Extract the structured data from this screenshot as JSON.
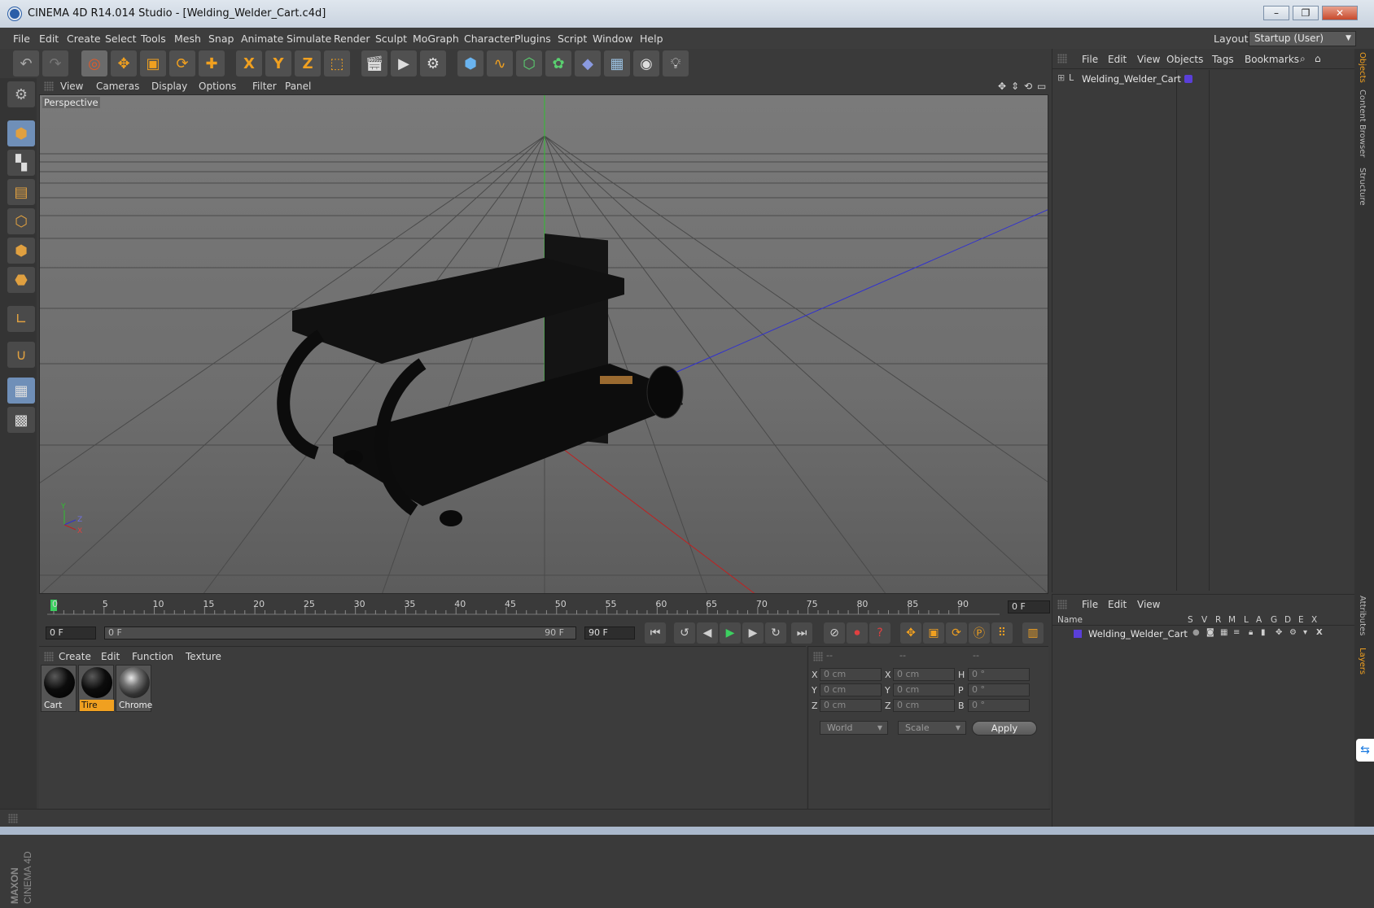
{
  "window": {
    "title": "CINEMA 4D R14.014 Studio - [Welding_Welder_Cart.c4d]",
    "buttons": [
      "–",
      "❐",
      "✕"
    ]
  },
  "menubar": {
    "items": [
      "File",
      "Edit",
      "Create",
      "Select",
      "Tools",
      "Mesh",
      "Snap",
      "Animate",
      "Simulate",
      "Render",
      "Sculpt",
      "MoGraph",
      "Character",
      "Plugins",
      "Script",
      "Window",
      "Help"
    ],
    "layout_label": "Layout:",
    "layout_value": "Startup (User)"
  },
  "toolbar": {
    "axis_x": "X",
    "axis_y": "Y",
    "axis_z": "Z"
  },
  "viewport": {
    "menu": [
      "View",
      "Cameras",
      "Display",
      "Options",
      "Filter",
      "Panel"
    ],
    "camera_label": "Perspective",
    "axis_gizmo": {
      "y": "Y",
      "z": "Z",
      "x": "X"
    }
  },
  "timeline": {
    "ticks": [
      "0",
      "5",
      "10",
      "15",
      "20",
      "25",
      "30",
      "35",
      "40",
      "45",
      "50",
      "55",
      "60",
      "65",
      "70",
      "75",
      "80",
      "85",
      "90"
    ],
    "current_frame": "0 F",
    "start_frame": "0 F",
    "range_start": "0 F",
    "range_end": "90 F",
    "end_frame": "90 F"
  },
  "materials": {
    "menu": [
      "Create",
      "Edit",
      "Function",
      "Texture"
    ],
    "items": [
      {
        "name": "Cart",
        "selected": false
      },
      {
        "name": "Tire",
        "selected": true
      },
      {
        "name": "Chrome",
        "selected": false
      }
    ]
  },
  "coordinates": {
    "headers": [
      "--",
      "--",
      "--"
    ],
    "position": [
      {
        "axis": "X",
        "value": "0 cm"
      },
      {
        "axis": "Y",
        "value": "0 cm"
      },
      {
        "axis": "Z",
        "value": "0 cm"
      }
    ],
    "size": [
      {
        "axis": "X",
        "value": "0 cm"
      },
      {
        "axis": "Y",
        "value": "0 cm"
      },
      {
        "axis": "Z",
        "value": "0 cm"
      }
    ],
    "rotation": [
      {
        "axis": "H",
        "value": "0 °"
      },
      {
        "axis": "P",
        "value": "0 °"
      },
      {
        "axis": "B",
        "value": "0 °"
      }
    ],
    "mode": "World",
    "size_mode": "Scale",
    "apply_label": "Apply"
  },
  "objects": {
    "menu": [
      "File",
      "Edit",
      "View",
      "Objects",
      "Tags",
      "Bookmarks"
    ],
    "tree": [
      {
        "name": "Welding_Welder_Cart",
        "color": "#5a3fd8"
      }
    ]
  },
  "layers": {
    "menu": [
      "File",
      "Edit",
      "View"
    ],
    "columns": [
      "Name",
      "S",
      "V",
      "R",
      "M",
      "L",
      "A",
      "G",
      "D",
      "E",
      "X"
    ],
    "rows": [
      {
        "name": "Welding_Welder_Cart",
        "color": "#5a3fd8"
      }
    ]
  },
  "side_tabs": [
    "Objects",
    "Content Browser",
    "Structure",
    "Attributes",
    "Layers"
  ],
  "brand": {
    "line1": "MAXON",
    "line2": "CINEMA 4D"
  },
  "colors": {
    "accent_orange": "#f0a020",
    "selection_blue": "#6f8fb8",
    "bg": "#3a3a3a"
  }
}
